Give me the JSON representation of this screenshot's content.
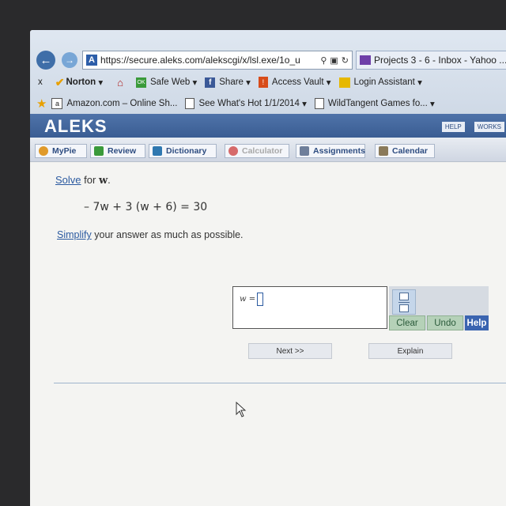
{
  "browser": {
    "address": "https://secure.aleks.com/alekscgi/x/lsl.exe/1o_u",
    "tab_title": "Projects 3 - 6 - Inbox - Yahoo ...",
    "toolbar": {
      "close": "x",
      "norton": "Norton",
      "safe_web": "Safe Web",
      "share": "Share",
      "access_vault": "Access Vault",
      "login_assistant": "Login Assistant"
    },
    "favorites": [
      "Amazon.com – Online Sh...",
      "See What's Hot 1/1/2014",
      "WildTangent Games fo..."
    ]
  },
  "aleks": {
    "logo": "ALEKS",
    "help": "HELP",
    "works": "WORKS",
    "nav": [
      "MyPie",
      "Review",
      "Dictionary",
      "Calculator",
      "Assignments",
      "Calendar"
    ]
  },
  "problem": {
    "solve_link": "Solve",
    "solve_rest": " for ",
    "variable": "w",
    "period": ".",
    "equation": "– 7w + 3 (w + 6) = 30",
    "simplify_link": "Simplify",
    "simplify_rest": " your answer as much as possible.",
    "answer_label": "w =",
    "answer_value": ""
  },
  "buttons": {
    "clear": "Clear",
    "undo": "Undo",
    "help": "Help",
    "next": "Next >>",
    "explain": "Explain"
  },
  "colors": {
    "aleks_blue": "#3a5d93",
    "link": "#2b5aa0",
    "help_button": "#3a64b0",
    "green_button": "#b5d1b8"
  }
}
